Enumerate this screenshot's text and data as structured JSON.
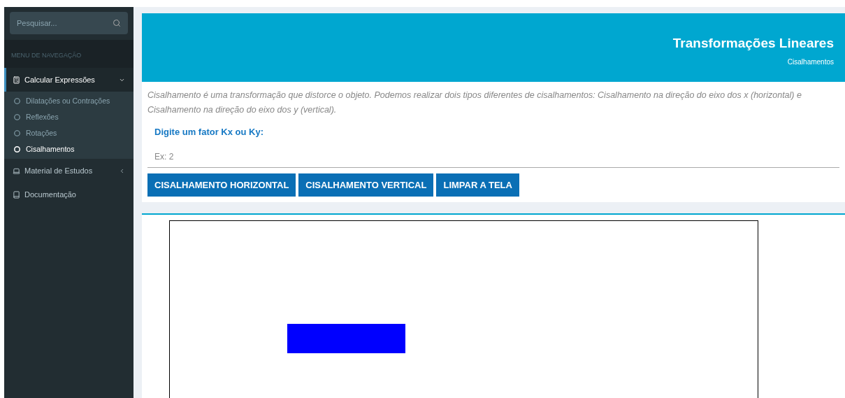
{
  "sidebar": {
    "search": {
      "placeholder": "Pesquisar..."
    },
    "section_title": "MENU DE NAVEGAÇÃO",
    "items": [
      {
        "label": "Calcular Expressões",
        "kind": "calculator",
        "expanded": true,
        "children": [
          {
            "label": "Dilatações ou Contrações",
            "selected": false
          },
          {
            "label": "Reflexões",
            "selected": false
          },
          {
            "label": "Rotações",
            "selected": false
          },
          {
            "label": "Cisalhamentos",
            "selected": true
          }
        ]
      },
      {
        "label": "Material de Estudos",
        "kind": "laptop",
        "expanded": false
      },
      {
        "label": "Documentação",
        "kind": "book"
      }
    ]
  },
  "header": {
    "title": "Transformações Lineares",
    "breadcrumb": "Cisalhamentos"
  },
  "description": "Cisalhamento é uma transformação que distorce o objeto. Podemos realizar dois tipos diferentes de cisalhamentos: Cisalhamento na direção do eixo dos x (horizontal) e Cisalhamento na direção do eixo dos y (vertical).",
  "field": {
    "label": "Digite um fator Kx ou Ky:",
    "placeholder": "Ex: 2"
  },
  "buttons": [
    "CISALHAMENTO HORIZONTAL",
    "CISALHAMENTO VERTICAL",
    "LIMPAR A TELA"
  ]
}
